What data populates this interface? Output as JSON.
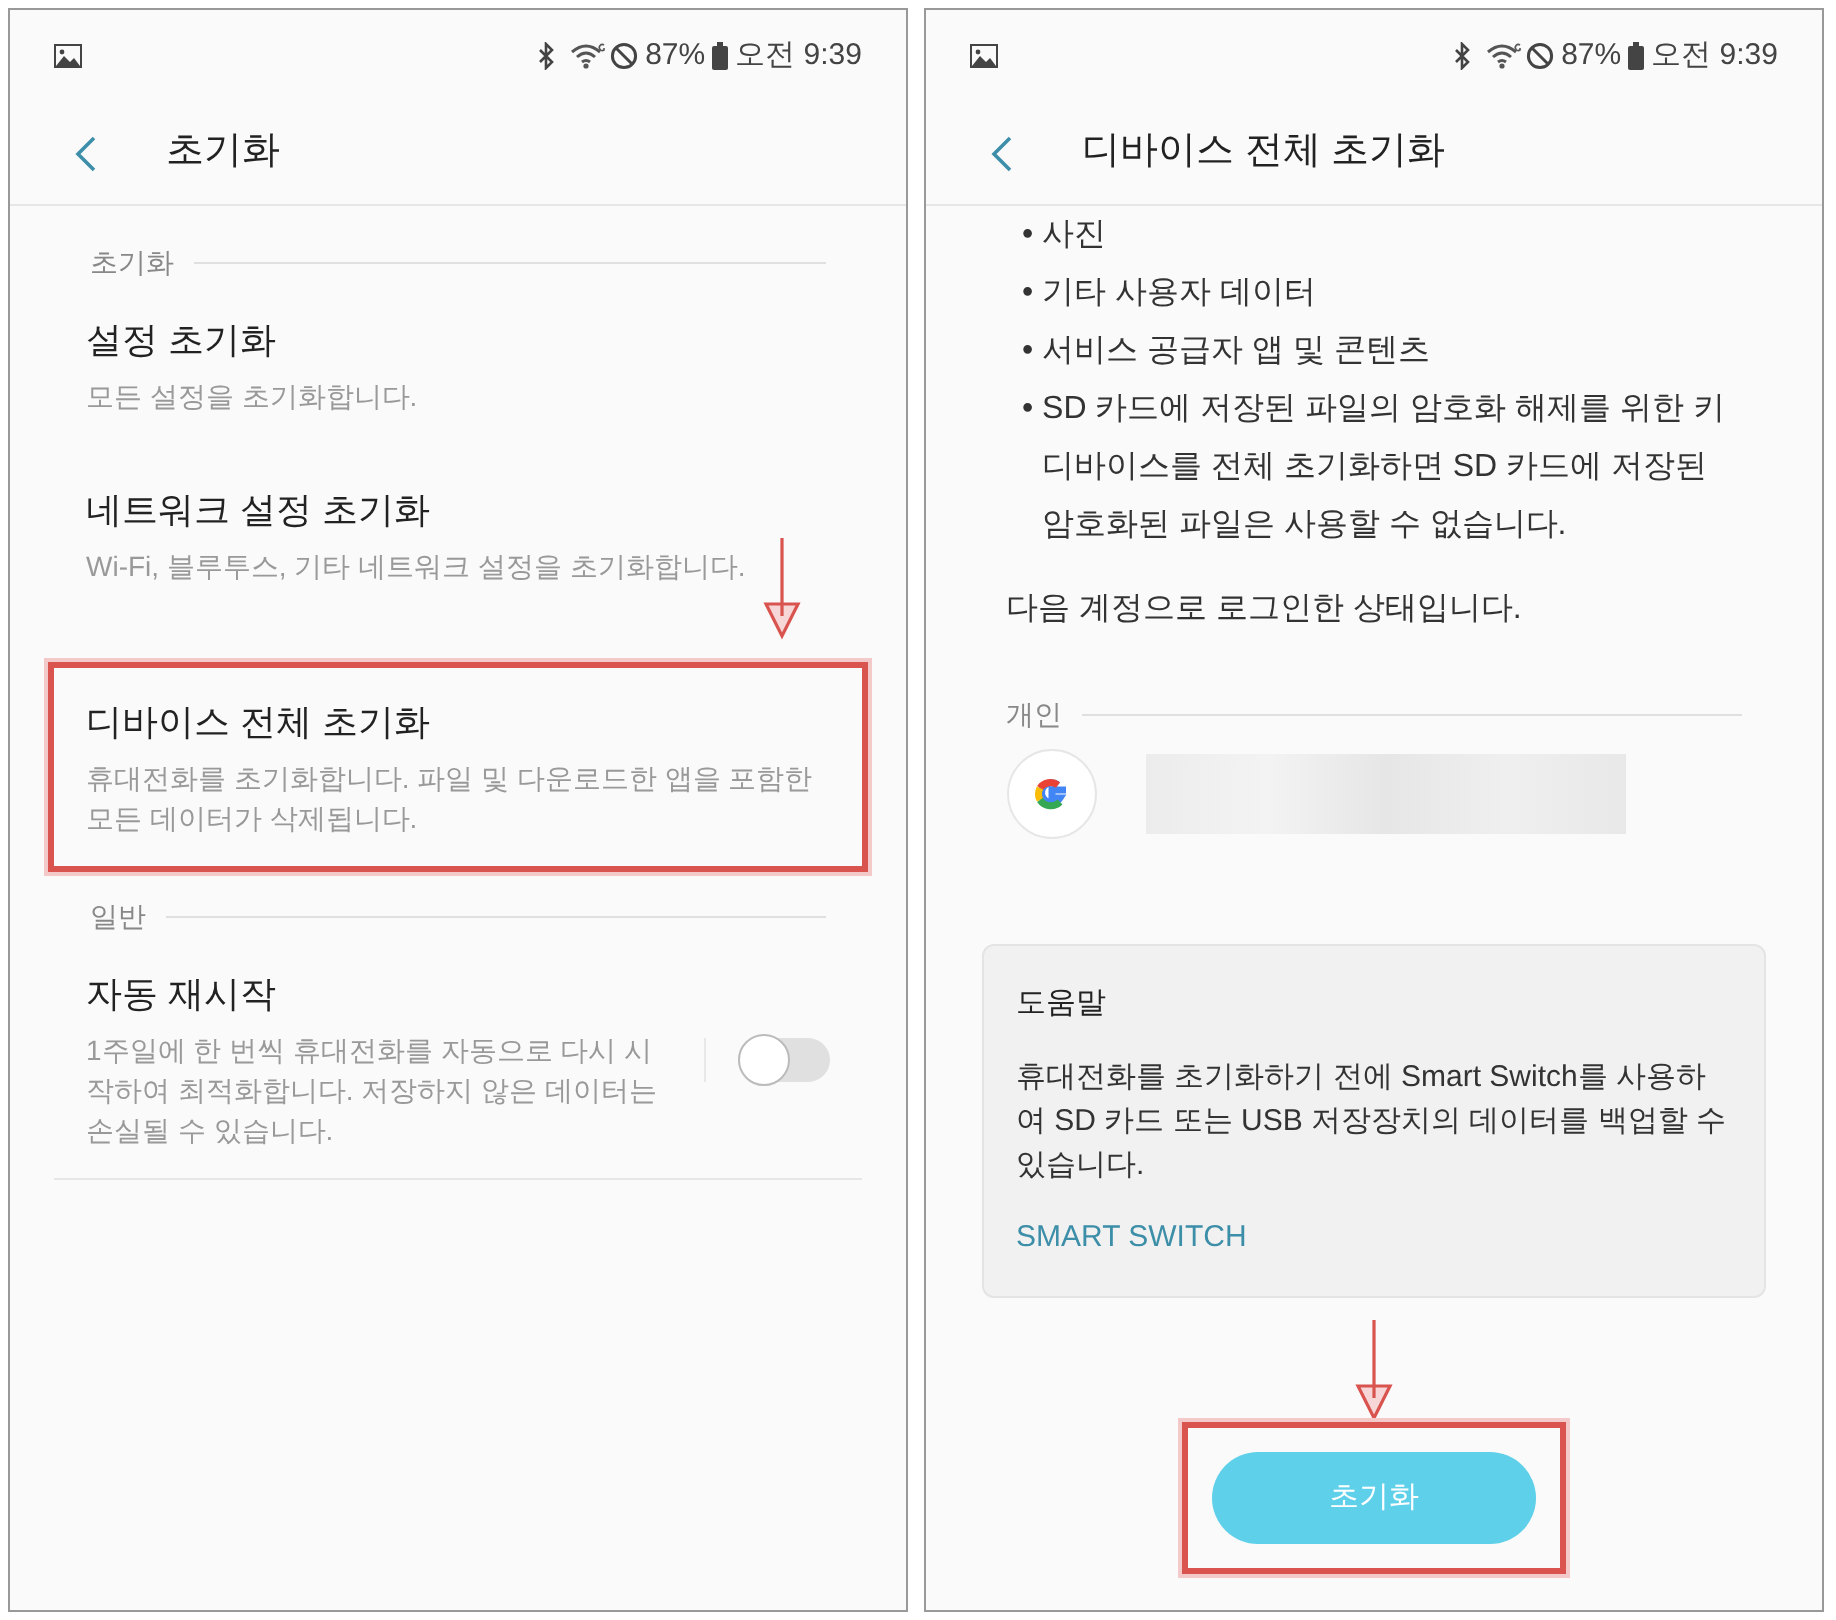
{
  "screens": [
    {
      "status_bar": {
        "battery": "87%",
        "time": "오전 9:39"
      },
      "title": "초기화",
      "sections": [
        {
          "header": "초기화",
          "items": [
            {
              "kind": "item",
              "title": "설정 초기화",
              "subtitle": "모든 설정을 초기화합니다.",
              "highlighted": false
            },
            {
              "kind": "item",
              "title": "네트워크 설정 초기화",
              "subtitle": "Wi-Fi, 블루투스, 기타 네트워크 설정을 초기화합니다.",
              "highlighted": false
            },
            {
              "kind": "item",
              "title": "디바이스 전체 초기화",
              "subtitle": "휴대전화를 초기화합니다. 파일 및 다운로드한 앱을 포함한 모든 데이터가 삭제됩니다.",
              "highlighted": true
            }
          ]
        },
        {
          "header": "일반",
          "items": [
            {
              "kind": "toggle",
              "title": "자동 재시작",
              "subtitle": "1주일에 한 번씩 휴대전화를 자동으로 다시 시작하여 최적화합니다. 저장하지 않은 데이터는 손실될 수 있습니다.",
              "on": false,
              "highlighted": false
            }
          ]
        }
      ]
    },
    {
      "status_bar": {
        "battery": "87%",
        "time": "오전 9:39"
      },
      "title": "디바이스 전체 초기화",
      "bullets": [
        "• 사진",
        "• 기타 사용자 데이터",
        "• 서비스 공급자 앱 및 콘텐츠",
        "• SD 카드에 저장된 파일의 암호화 해제를 위한 키"
      ],
      "note": "디바이스를 전체 초기화하면 SD 카드에 저장된 암호화된 파일은 사용할 수 없습니다.",
      "account_intro": "다음 계정으로 로그인한 상태입니다.",
      "account_header": "개인",
      "help": {
        "title": "도움말",
        "body": "휴대전화를 초기화하기 전에 Smart Switch를 사용하여 SD 카드 또는 USB 저장장치의 데이터를 백업할 수 있습니다.",
        "link": "SMART SWITCH"
      },
      "button": {
        "label": "초기화",
        "highlighted": true
      }
    }
  ]
}
